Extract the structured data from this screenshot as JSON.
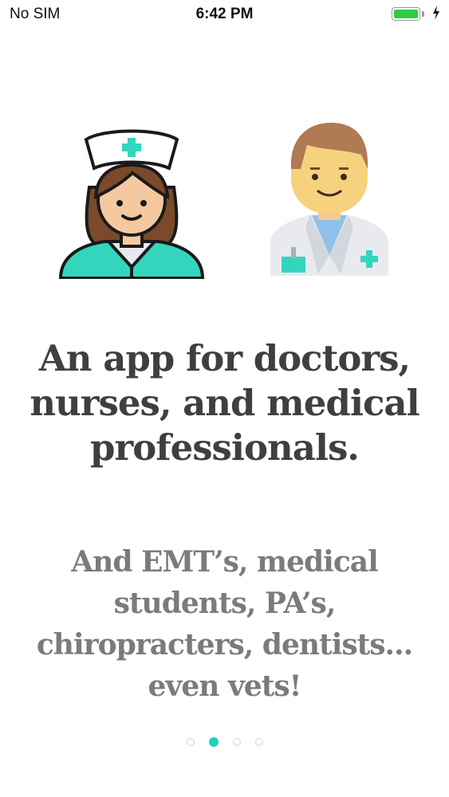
{
  "status_bar": {
    "carrier": "No SIM",
    "time": "6:42 PM",
    "battery_level": 1.0,
    "battery_color": "#2ecc40"
  },
  "onboarding": {
    "headline": "An app for doctors, nurses, and medical professionals.",
    "subtext": "And EMT’s, medical students, PA’s, chiropracters, dentists... even vets!",
    "illustrations": [
      "nurse-icon",
      "doctor-icon"
    ]
  },
  "pagination": {
    "page_count": 4,
    "active_index": 1,
    "active_color": "#19d2c1"
  }
}
